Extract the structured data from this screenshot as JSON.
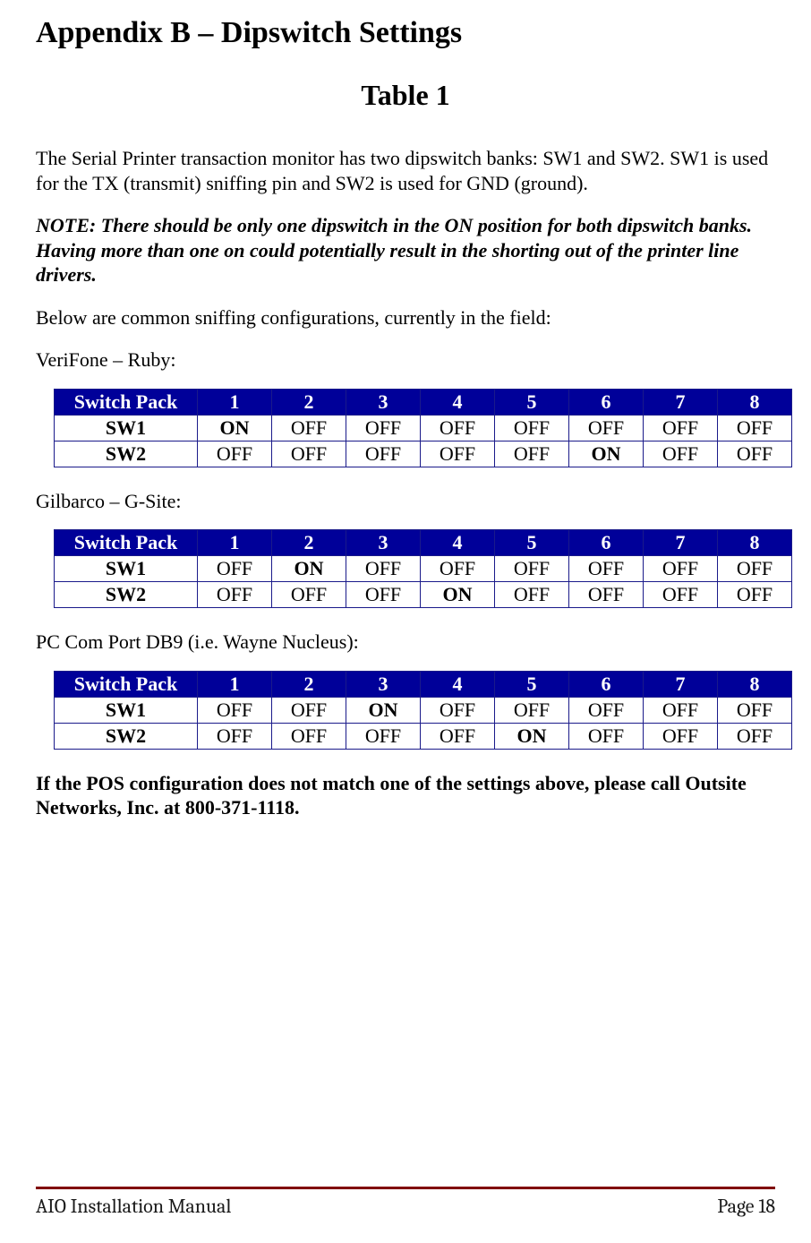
{
  "heading": "Appendix B – Dipswitch Settings",
  "subheading": "Table 1",
  "intro": "The Serial Printer transaction monitor has two dipswitch banks: SW1 and SW2. SW1 is used for the TX (transmit) sniffing pin and SW2 is used for GND (ground).",
  "note": "NOTE: There should be only one dipswitch in the ON position for both dipswitch banks. Having more than one on could potentially result in the shorting out of the printer line drivers.",
  "below_intro": "Below are common sniffing configurations, currently in the field:",
  "closing": "If the POS configuration does not match one of the settings above, please call Outsite Networks, Inc. at 800-371-1118.",
  "header_label": "Switch Pack",
  "columns": [
    "1",
    "2",
    "3",
    "4",
    "5",
    "6",
    "7",
    "8"
  ],
  "configs": [
    {
      "label": "VeriFone – Ruby:",
      "rows": [
        {
          "name": "SW1",
          "cells": [
            "ON",
            "OFF",
            "OFF",
            "OFF",
            "OFF",
            "OFF",
            "OFF",
            "OFF"
          ]
        },
        {
          "name": "SW2",
          "cells": [
            "OFF",
            "OFF",
            "OFF",
            "OFF",
            "OFF",
            "ON",
            "OFF",
            "OFF"
          ]
        }
      ]
    },
    {
      "label": "Gilbarco – G-Site:",
      "rows": [
        {
          "name": "SW1",
          "cells": [
            "OFF",
            "ON",
            "OFF",
            "OFF",
            "OFF",
            "OFF",
            "OFF",
            "OFF"
          ]
        },
        {
          "name": "SW2",
          "cells": [
            "OFF",
            "OFF",
            "OFF",
            "ON",
            "OFF",
            "OFF",
            "OFF",
            "OFF"
          ]
        }
      ]
    },
    {
      "label": "PC Com Port DB9 (i.e. Wayne Nucleus):",
      "rows": [
        {
          "name": "SW1",
          "cells": [
            "OFF",
            "OFF",
            "ON",
            "OFF",
            "OFF",
            "OFF",
            "OFF",
            "OFF"
          ]
        },
        {
          "name": "SW2",
          "cells": [
            "OFF",
            "OFF",
            "OFF",
            "OFF",
            "ON",
            "OFF",
            "OFF",
            "OFF"
          ]
        }
      ]
    }
  ],
  "footer": {
    "left": "AIO Installation Manual",
    "right": "Page 18"
  }
}
